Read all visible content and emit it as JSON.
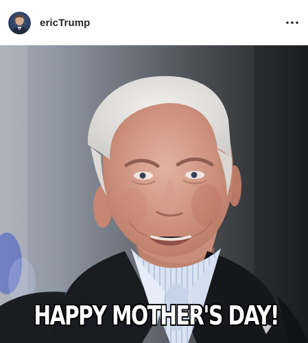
{
  "post": {
    "username": "ericTrump",
    "menu_icon": "more-horizontal-icon",
    "avatar_icon": "profile-avatar"
  },
  "image": {
    "caption": "HAPPY MOTHER'S DAY!"
  }
}
